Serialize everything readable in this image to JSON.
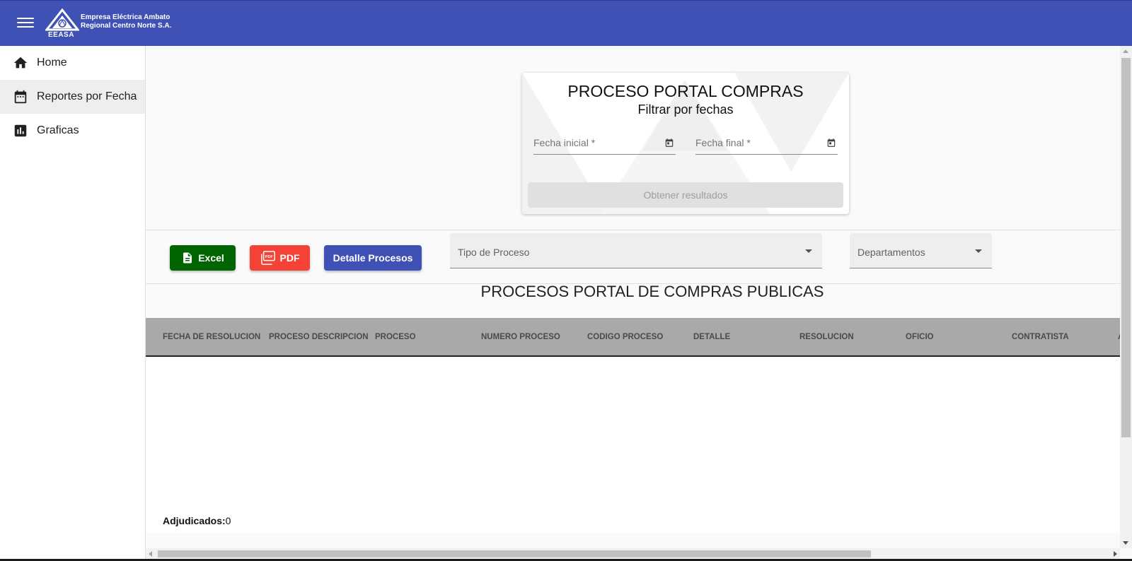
{
  "header": {
    "company_line1": "Empresa Eléctrica Ambato",
    "company_line2": "Regional Centro Norte S.A.",
    "logo_acronym": "EEASA",
    "color": "#3f51b5"
  },
  "sidebar": {
    "items": [
      {
        "label": "Home",
        "icon": "home-icon"
      },
      {
        "label": "Reportes por Fecha",
        "icon": "calendar-icon",
        "active": true
      },
      {
        "label": "Graficas",
        "icon": "bar-chart-icon"
      }
    ]
  },
  "filter_card": {
    "title": "PROCESO PORTAL COMPRAS",
    "subtitle": "Filtrar por fechas",
    "start_date_label": "Fecha inicial *",
    "end_date_label": "Fecha final *",
    "submit_label": "Obtener resultados"
  },
  "toolbar": {
    "excel_label": "Excel",
    "pdf_label": "PDF",
    "detalle_label": "Detalle Procesos",
    "tipo_proceso_label": "Tipo de Proceso",
    "departamentos_label": "Departamentos",
    "colors": {
      "excel": "#006400",
      "pdf": "#f44336",
      "detalle": "#3f51b5"
    }
  },
  "table": {
    "title": "PROCESOS PORTAL DE COMPRAS PUBLICAS",
    "columns": [
      "FECHA DE RESOLUCION",
      "PROCESO DESCRIPCION",
      "PROCESO",
      "NUMERO PROCESO",
      "CODIGO PROCESO",
      "DETALLE",
      "RESOLUCION",
      "OFICIO",
      "CONTRATISTA",
      "A"
    ],
    "rows": [],
    "footer_label": "Adjudicados:",
    "footer_value": "0"
  }
}
